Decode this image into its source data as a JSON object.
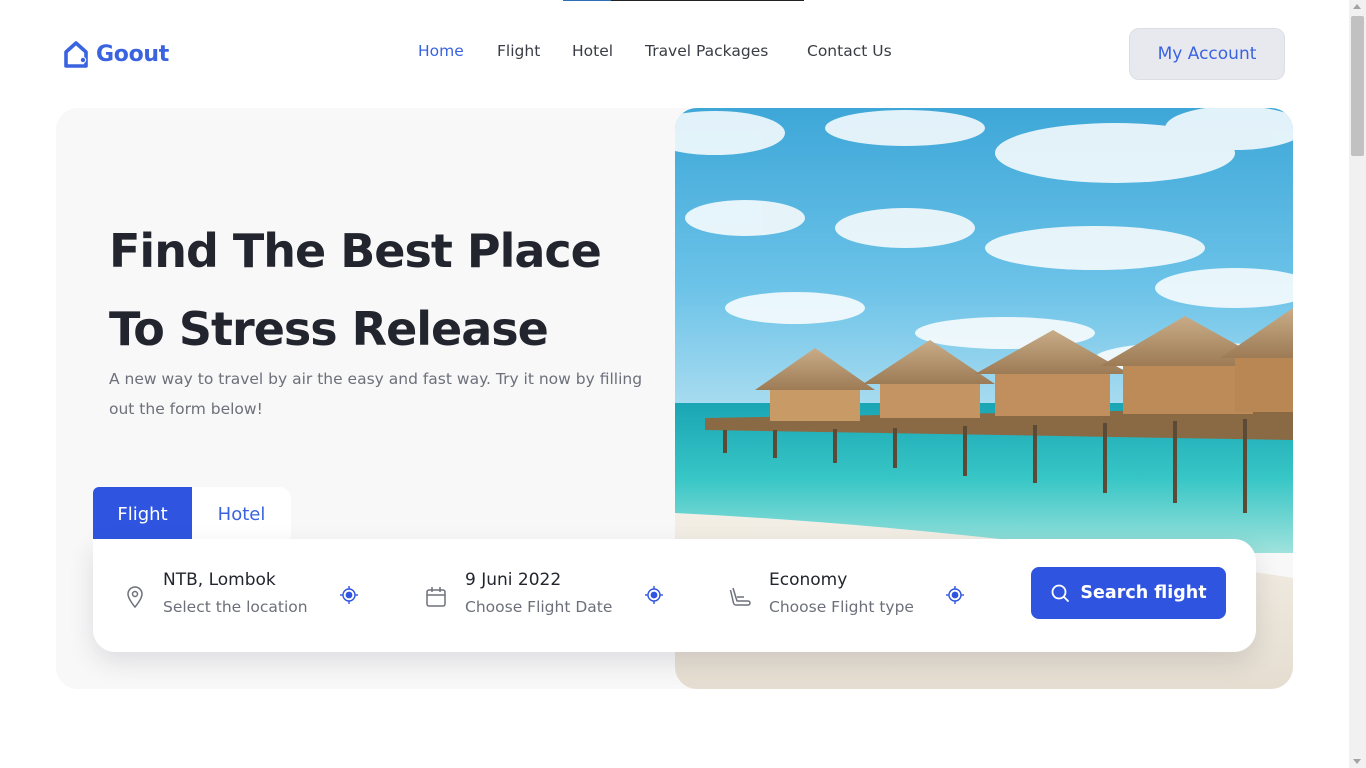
{
  "page_load_progress": 0.2,
  "brand": {
    "name": "Goout",
    "color": "#3a63e0"
  },
  "nav": {
    "items": [
      {
        "label": "Home",
        "active": true
      },
      {
        "label": "Flight",
        "active": false
      },
      {
        "label": "Hotel",
        "active": false
      },
      {
        "label": "Travel Packages",
        "active": false
      },
      {
        "label": "Contact Us",
        "active": false
      }
    ]
  },
  "account": {
    "label": "My Account"
  },
  "hero": {
    "headline_line1": "Find The Best Place",
    "headline_line2": "To Stress Release",
    "subtext": "A new way to travel by air the easy and fast way. Try it now by filling out the form below!"
  },
  "booking": {
    "tabs": [
      {
        "label": "Flight",
        "active": true
      },
      {
        "label": "Hotel",
        "active": false
      }
    ],
    "fields": [
      {
        "icon": "location-pin-icon",
        "value": "NTB, Lombok",
        "label": "Select the location"
      },
      {
        "icon": "calendar-icon",
        "value": "9 Juni 2022",
        "label": "Choose Flight Date"
      },
      {
        "icon": "seat-icon",
        "value": "Economy",
        "label": "Choose Flight type"
      }
    ],
    "search_button": {
      "label": "Search flight",
      "icon": "search-icon"
    }
  },
  "colors": {
    "accent": "#2f55e0",
    "accent_text": "#3a63e0",
    "hero_bg": "#f8f8f8",
    "text_dark": "#22252e",
    "text_muted": "#6d707a"
  }
}
